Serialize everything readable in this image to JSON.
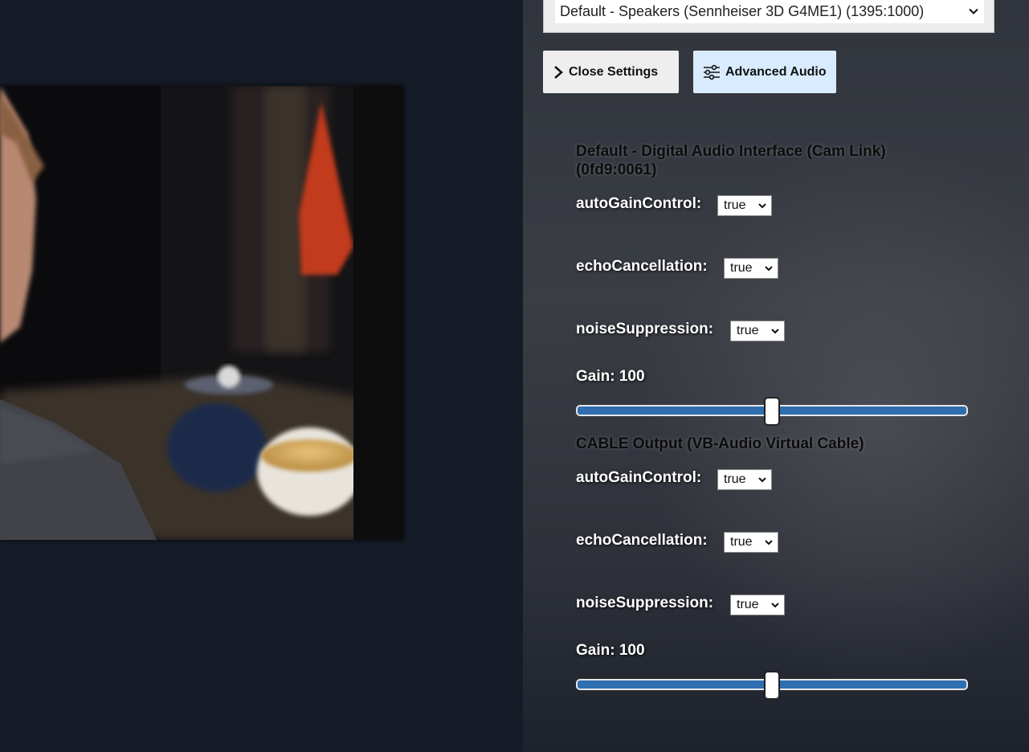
{
  "video": {
    "alt": "camera preview"
  },
  "speaker_select": {
    "value": "Default - Speakers (Sennheiser 3D G4ME1) (1395:1000)"
  },
  "buttons": {
    "close_settings": "Close Settings",
    "advanced_audio": "Advanced Audio"
  },
  "devices": [
    {
      "title": "Default - Digital Audio Interface (Cam Link) (0fd9:0061)",
      "options": [
        {
          "label": "autoGainControl:",
          "value": "true"
        },
        {
          "label": "echoCancellation:",
          "value": "true"
        },
        {
          "label": "noiseSuppression:",
          "value": "true"
        }
      ],
      "gain_label": "Gain: 100",
      "gain_fraction": 0.5
    },
    {
      "title": "CABLE Output (VB-Audio Virtual Cable)",
      "options": [
        {
          "label": "autoGainControl:",
          "value": "true"
        },
        {
          "label": "echoCancellation:",
          "value": "true"
        },
        {
          "label": "noiseSuppression:",
          "value": "true"
        }
      ],
      "gain_label": "Gain: 100",
      "gain_fraction": 0.5
    }
  ],
  "colors": {
    "slider_fill": "#2f6eb0",
    "advanced_button_bg": "#d9ecff",
    "page_bg": "#151b27"
  },
  "icons": {
    "close_settings": "chevron-right-icon",
    "advanced_audio": "sliders-icon",
    "select": "chevron-down-icon"
  }
}
